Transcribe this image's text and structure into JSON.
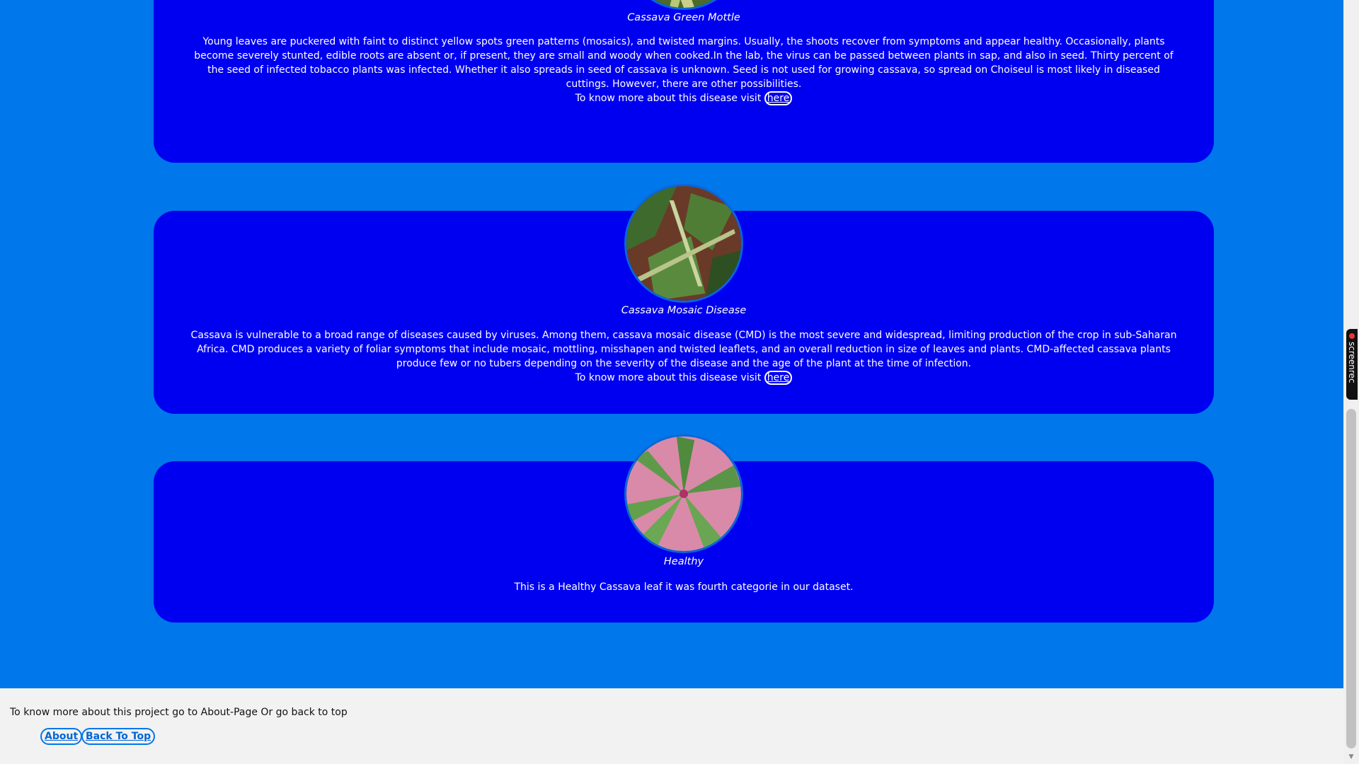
{
  "cards": [
    {
      "name": "Cassava Green Mottle",
      "description": "Young leaves are puckered with faint to distinct yellow spots green patterns (mosaics), and twisted margins. Usually, the shoots recover from symptoms and appear healthy. Occasionally, plants become severely stunted, edible roots are absent or, if present, they are small and woody when cooked.In the lab, the virus can be passed between plants in sap, and also in seed. Thirty percent of the seed of infected tobacco plants was infected. Whether it also spreads in seed of cassava is unknown. Seed is not used for growing cassava, so spread on Choiseul is most likely in diseased cuttings. However, there are other possibilities.",
      "visit_text": "To know more about this disease visit",
      "link_label": "here"
    },
    {
      "name": "Cassava Mosaic Disease",
      "description": "Cassava is vulnerable to a broad range of diseases caused by viruses. Among them, cassava mosaic disease (CMD) is the most severe and widespread, limiting production of the crop in sub-Saharan Africa. CMD produces a variety of foliar symptoms that include mosaic, mottling, misshapen and twisted leaflets, and an overall reduction in size of leaves and plants. CMD-affected cassava plants produce few or no tubers depending on the severity of the disease and the age of the plant at the time of infection.",
      "visit_text": "To know more about this disease visit",
      "link_label": "here"
    },
    {
      "name": "Healthy",
      "description": "This is a Healthy Cassava leaf it was fourth categorie in our dataset."
    }
  ],
  "footer": {
    "text": "To know more about this project go to About-Page Or go back to top",
    "about_label": "About",
    "back_to_top_label": "Back To Top"
  },
  "badge": {
    "label": "screenrec"
  },
  "colors": {
    "page_background": "#0077ea",
    "card_background": "#0000f0",
    "footer_background": "#f2f2f2",
    "text": "#ffffff"
  }
}
